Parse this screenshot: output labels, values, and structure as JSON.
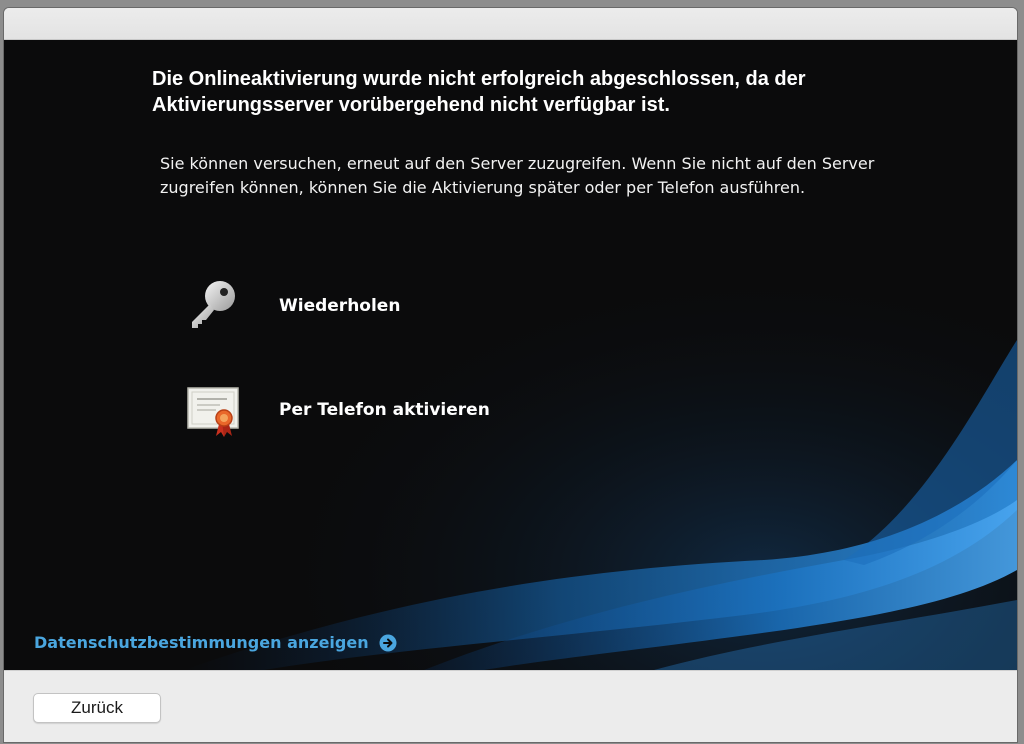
{
  "dialog": {
    "headline": "Die Onlineaktivierung wurde nicht erfolgreich abgeschlossen, da der Aktivierungsserver vorübergehend nicht verfügbar ist.",
    "message": "Sie können versuchen, erneut auf den Server zuzugreifen. Wenn Sie nicht auf den Server zugreifen können, können Sie die Aktivierung später oder per Telefon ausführen.",
    "options": [
      {
        "label": "Wiederholen",
        "icon": "key-icon"
      },
      {
        "label": "Per Telefon aktivieren",
        "icon": "certificate-icon"
      }
    ],
    "privacy_link": {
      "label": "Datenschutzbestimmungen anzeigen",
      "icon": "arrow-right-circle-icon"
    }
  },
  "footer": {
    "back_label": "Zurück"
  },
  "colors": {
    "content_background": "#0b0b0c",
    "link": "#4aa6df",
    "swoosh": "#1e6fb0",
    "chrome": "#ececec"
  }
}
